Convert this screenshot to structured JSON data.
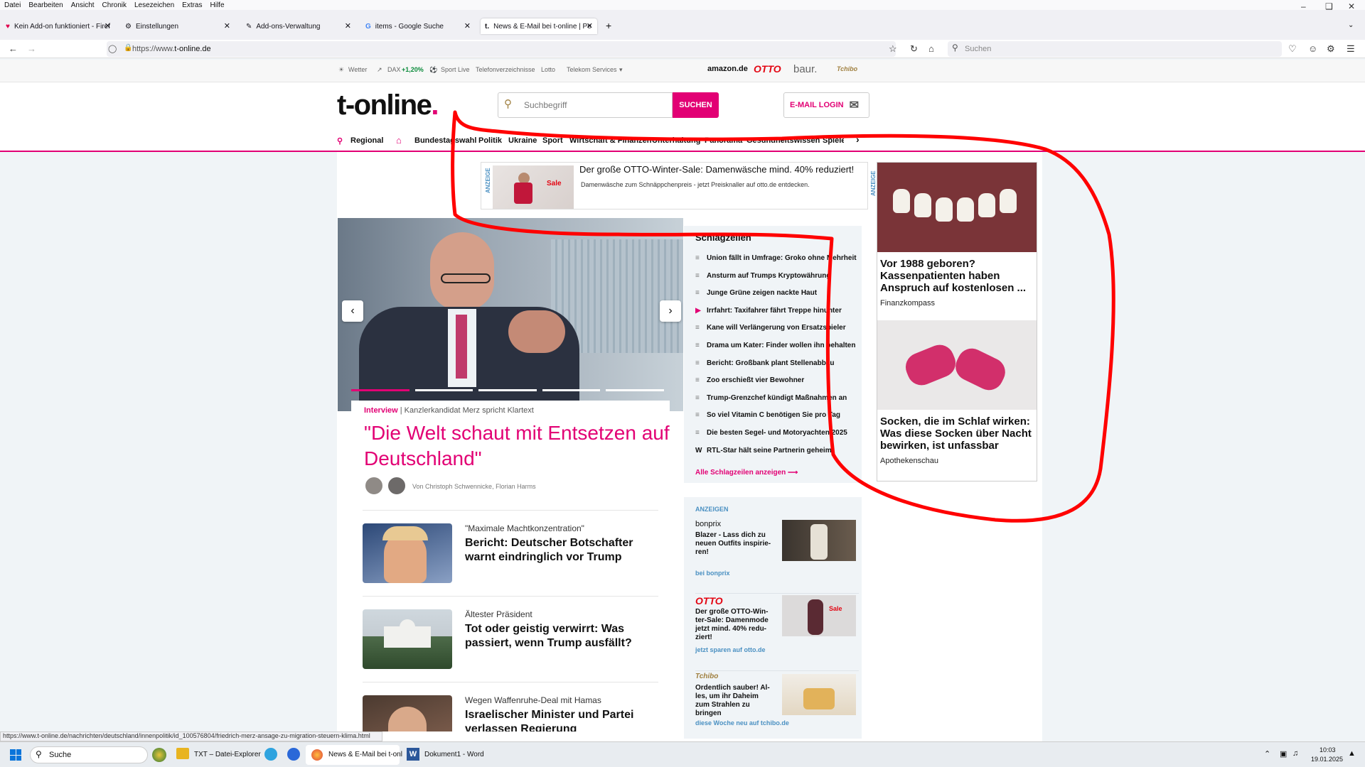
{
  "menubar": [
    "Datei",
    "Bearbeiten",
    "Ansicht",
    "Chronik",
    "Lesezeichen",
    "Extras",
    "Hilfe"
  ],
  "tabs": [
    {
      "label": "Kein Add-on funktioniert - Firef",
      "icon": "firefox-help-icon"
    },
    {
      "label": "Einstellungen",
      "icon": "gear-icon"
    },
    {
      "label": "Add-ons-Verwaltung",
      "icon": "puzzle-icon"
    },
    {
      "label": "items - Google Suche",
      "icon": "google-icon"
    },
    {
      "label": "News & E-Mail bei t-online | Pe",
      "icon": "t-online-icon",
      "active": true
    }
  ],
  "address": {
    "url_prefix": "https://www.",
    "url_domain": "t-online.de"
  },
  "browser_search": {
    "placeholder": "Suchen"
  },
  "topstrip": {
    "weather": "Wetter",
    "dax_label": "DAX",
    "dax_value": "+1,20%",
    "sport": "Sport Live",
    "phone": "Telefonverzeichnisse",
    "lotto": "Lotto",
    "telekom": "Telekom Services",
    "partners": [
      "amazon.de",
      "OTTO",
      "baur.",
      "Tchibo"
    ]
  },
  "header": {
    "logo": "t-online",
    "search_placeholder": "Suchbegriff",
    "search_button": "SUCHEN",
    "email_login": "E-MAIL LOGIN"
  },
  "nav": {
    "regional": "Regional",
    "items": [
      "Bundestagswahl",
      "Politik",
      "Ukraine",
      "Sport",
      "Wirtschaft & Finanzen",
      "Unterhaltung",
      "Panorama",
      "Gesundheitswissen",
      "Spiele"
    ]
  },
  "ad_top": {
    "label": "ANZEIGE",
    "title": "Der große OTTO-Winter-Sale: Damenwäsche mind. 40% reduziert!",
    "text": "Damenwäsche zum Schnäppchenpreis - jetzt Preisknaller auf otto.de entdecken.",
    "badge": "Sale"
  },
  "hero": {
    "kicker": "Interview",
    "kicker_sub": "Kanzlerkandidat Merz spricht Klartext",
    "title": "\"Die Welt schaut mit Entsetzen auf Deutschland\"",
    "authors": "Von Christoph Schwennicke, Florian Harms",
    "slide_count": 5,
    "active_slide": 1
  },
  "teasers": [
    {
      "kicker": "\"Maximale Machtkonzentration\"",
      "title": "Bericht: Deutscher Botschafter warnt eindringlich vor Trump"
    },
    {
      "kicker": "Ältester Präsident",
      "title": "Tot oder geistig verwirrt: Was passiert, wenn Trump ausfällt?"
    },
    {
      "kicker": "Wegen Waffenruhe-Deal mit Hamas",
      "title": "Israelischer Minister und Partei verlassen Regierung"
    }
  ],
  "headlines": {
    "title": "Schlagzeilen",
    "items": [
      {
        "text": "Union fällt in Umfrage: Groko ohne Mehrheit",
        "icon": "article-icon"
      },
      {
        "text": "Ansturm auf Trumps Kryptowährung",
        "icon": "article-icon"
      },
      {
        "text": "Junge Grüne zeigen nackte Haut",
        "icon": "article-icon"
      },
      {
        "text": "Irrfahrt: Taxifahrer fährt Treppe hinunter",
        "icon": "video-play-icon"
      },
      {
        "text": "Kane will Verlängerung von Ersatzspieler",
        "icon": "article-icon"
      },
      {
        "text": "Drama um Kater: Finder wollen ihn behalten",
        "icon": "article-icon"
      },
      {
        "text": "Bericht: Großbank plant Stellenabbau",
        "icon": "article-icon"
      },
      {
        "text": "Zoo erschießt vier Bewohner",
        "icon": "article-icon"
      },
      {
        "text": "Trump-Grenzchef kündigt Maßnahmen an",
        "icon": "article-icon"
      },
      {
        "text": "So viel Vitamin C benötigen Sie pro Tag",
        "icon": "article-icon"
      },
      {
        "text": "Die besten Segel- und Motoryachten 2025",
        "icon": "article-icon"
      },
      {
        "text": "RTL-Star hält seine Partnerin geheim",
        "icon": "w-icon"
      }
    ],
    "all_link": "Alle Schlagzeilen anzeigen"
  },
  "ads": {
    "label": "ANZEIGEN",
    "items": [
      {
        "brand": "bonprix",
        "text": "Blazer - Lass dich zu neuen Outfits inspirie-ren!",
        "link": "bei bonprix"
      },
      {
        "brand": "OTTO",
        "text": "Der große OTTO-Win-ter-Sale: Damenmode jetzt mind. 40% redu-ziert!",
        "link": "jetzt sparen auf otto.de",
        "badge": "Sale"
      },
      {
        "brand": "Tchibo",
        "text": "Ordentlich sauber! Al-les, um ihr Daheim zum Strahlen zu bringen",
        "link": "diese Woche neu auf tchibo.de"
      }
    ]
  },
  "right_ad": {
    "label": "ANZEIGE",
    "items": [
      {
        "title": "Vor 1988 geboren? Kassenpatienten haben Anspruch auf kostenlosen ...",
        "source": "Finanzkompass"
      },
      {
        "title": "Socken, die im Schlaf wirken: Was diese Socken über Nacht bewirken, ist unfassbar",
        "source": "Apothekenschau"
      }
    ]
  },
  "status_url": "https://www.t-online.de/nachrichten/deutschland/innenpolitik/id_100576804/friedrich-merz-ansage-zu-migration-steuern-klima.html",
  "taskbar": {
    "search": "Suche",
    "apps": [
      {
        "label": "TXT – Datei-Explorer"
      },
      {
        "label": "News & E-Mail bei t-onl"
      },
      {
        "label": "Dokument1 - Word"
      }
    ],
    "time": "10:03",
    "date": "19.01.2025"
  },
  "colors": {
    "brand": "#e20074",
    "annotation": "#ff0000"
  }
}
